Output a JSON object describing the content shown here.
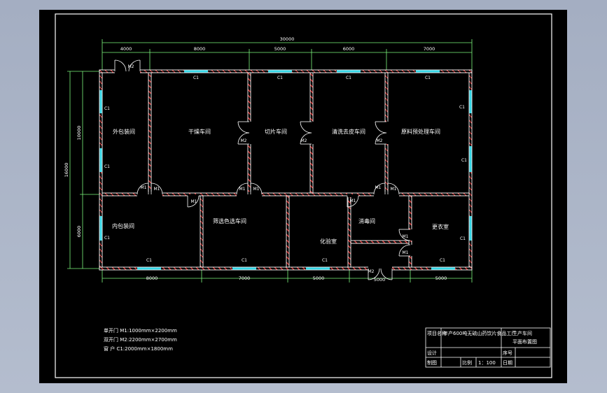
{
  "overall_dimension": "30000",
  "top_dimensions": [
    "4000",
    "8000",
    "5000",
    "6000",
    "7000"
  ],
  "bottom_dimensions": [
    "8000",
    "7000",
    "5000",
    "5000",
    "5000"
  ],
  "left_dimensions": {
    "total": "16000",
    "upper": "10000",
    "lower": "6000"
  },
  "rooms": [
    "外包装间",
    "干燥车间",
    "切片车间",
    "清洗去皮车间",
    "原料预处理车间",
    "内包装间",
    "筛选色选车间",
    "化验室",
    "消毒间",
    "更衣室"
  ],
  "door_labels": {
    "single": "M1",
    "double": "M2"
  },
  "window_label": "C1",
  "legend": [
    "单开门 M1:1000mm×2200mm",
    "双开门 M2:2200mm×2700mm",
    "窗    户 C1:2000mm×1800mm"
  ],
  "title_block": {
    "project_label": "项目名称",
    "project_name": "年产600吨无硫山药饮片食品工厂",
    "drawing_title_1": "生产车间",
    "drawing_title_2": "平面布置图",
    "design_label": "设计",
    "number_label": "序号",
    "draw_label": "制图",
    "scale_label": "比例",
    "scale_value": "1：100",
    "date_label": "日期"
  },
  "colors": {
    "background": "#000000",
    "lines": "#ffffff",
    "wall_dash": "#e23b3b",
    "window": "#33d6e6",
    "dimension": "#7cf57c",
    "viewport": "#a9b3c6"
  }
}
